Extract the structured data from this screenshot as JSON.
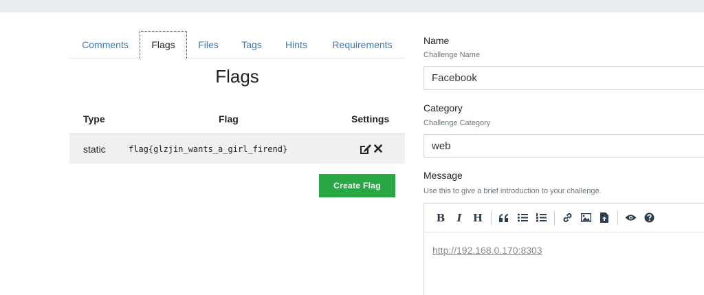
{
  "tabs": [
    {
      "label": "Comments",
      "active": false
    },
    {
      "label": "Flags",
      "active": true
    },
    {
      "label": "Files",
      "active": false
    },
    {
      "label": "Tags",
      "active": false
    },
    {
      "label": "Hints",
      "active": false
    },
    {
      "label": "Requirements",
      "active": false
    }
  ],
  "flags_section": {
    "title": "Flags",
    "columns": {
      "type": "Type",
      "flag": "Flag",
      "settings": "Settings"
    },
    "rows": [
      {
        "type": "static",
        "flag": "flag{glzjin_wants_a_girl_firend}"
      }
    ],
    "create_button": "Create Flag"
  },
  "form": {
    "name": {
      "label": "Name",
      "help": "Challenge Name",
      "value": "Facebook"
    },
    "category": {
      "label": "Category",
      "help": "Challenge Category",
      "value": "web"
    },
    "message": {
      "label": "Message",
      "help": "Use this to give a brief introduction to your challenge.",
      "content_link": "http://192.168.0.170:8303"
    }
  },
  "colors": {
    "tab_link": "#3c7ab4",
    "primary_button": "#28a745",
    "topbar": "#e9ecef"
  },
  "editor_toolbar_icons": [
    "bold-icon",
    "italic-icon",
    "heading-icon",
    "quote-icon",
    "unordered-list-icon",
    "ordered-list-icon",
    "link-icon",
    "image-icon",
    "upload-file-icon",
    "preview-eye-icon",
    "help-icon"
  ]
}
